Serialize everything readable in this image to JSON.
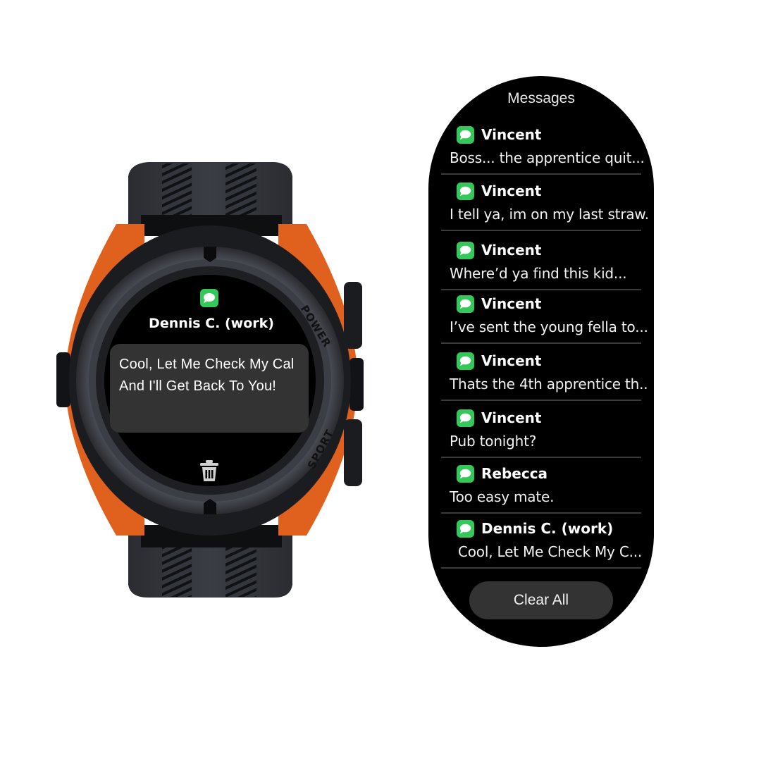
{
  "watch": {
    "bezel_labels": {
      "power": "POWER",
      "sport": "SPORT"
    },
    "notification": {
      "app_icon": "messages-icon",
      "sender": "Dennis C. (work)",
      "message_lines": [
        "Cool, Let Me Check My Cal",
        "And I'll Get Back To You!"
      ],
      "delete_icon": "trash-icon"
    },
    "colors": {
      "accent": "#e0601e",
      "screen": "#000000",
      "bubble": "#333333",
      "app_green": "#34c759"
    }
  },
  "messages_panel": {
    "title": "Messages",
    "items": [
      {
        "sender": "Vincent",
        "preview": "Boss... the apprentice quit...",
        "icon": "messages-icon"
      },
      {
        "sender": "Vincent",
        "preview": "I tell ya, im on my last straw.",
        "icon": "messages-icon"
      },
      {
        "sender": "Vincent",
        "preview": "Where’d ya find this kid...",
        "icon": "messages-icon"
      },
      {
        "sender": "Vincent",
        "preview": "I’ve sent the young fella to...",
        "icon": "messages-icon"
      },
      {
        "sender": "Vincent",
        "preview": "Thats the 4th apprentice th..",
        "icon": "messages-icon"
      },
      {
        "sender": "Vincent",
        "preview": "Pub tonight?",
        "icon": "messages-icon"
      },
      {
        "sender": "Rebecca",
        "preview": "Too easy mate.",
        "icon": "messages-icon"
      },
      {
        "sender": "Dennis C. (work)",
        "preview": "Cool, Let Me Check My C...",
        "icon": "messages-icon"
      }
    ],
    "clear_all_label": "Clear All",
    "colors": {
      "background": "#000000",
      "divider": "#3a3a3a",
      "button": "#333333"
    }
  }
}
